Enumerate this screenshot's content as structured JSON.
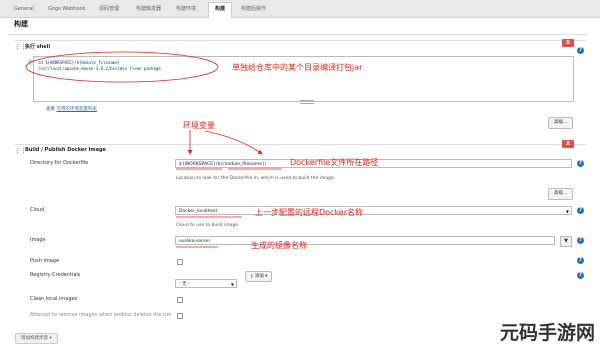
{
  "tabs": [
    "General",
    "Gogs Webhook",
    "源码管理",
    "构建触发器",
    "构建环境",
    "构建",
    "构建后操作"
  ],
  "page_title": "构建",
  "shell": {
    "title": "执行 shell",
    "close_label": "X",
    "command_label": "命令",
    "command_lines": [
      "cd ${WORKSPACE}/${module_filename}",
      "/usr/local/apache-maven-3.6.2/bin/mvn clean package"
    ],
    "see_prefix": "查看",
    "see_link": "可用的环境变量列表",
    "advanced": "高级..."
  },
  "docker": {
    "title": "Build / Publish Docker Image",
    "close_label": "X",
    "dockerfile_label": "Directory for Dockerfile",
    "dockerfile_value": "${WORKSPACE}/${module_filename}/",
    "dockerfile_hint": "Location to look for the Dockerfile in, which is used to build the image.",
    "advanced": "高级...",
    "cloud_label": "Cloud",
    "cloud_value": "Docker_localhost",
    "cloud_hint": "Cloud to use to build image",
    "image_label": "Image",
    "image_value": "eureka-server",
    "push_label": "Push image",
    "registry_label": "Registry Credentials",
    "registry_value": "- 无 -",
    "add_label": "添加",
    "clean_label": "Clean local images",
    "attempt_label": "Attempt to remove images when jenkins deletes the run"
  },
  "annotations": {
    "shell_note": "单独给仓库中的某个目录编译打包jar",
    "env_note": "环境变量",
    "dockerfile_note": "Dockerfile文件所在路径",
    "cloud_note": "上一步配置的远程Docker名称",
    "image_note": "生成的镜像名称"
  },
  "bottom_button": "增加构建步骤",
  "watermark": "元码手游网"
}
